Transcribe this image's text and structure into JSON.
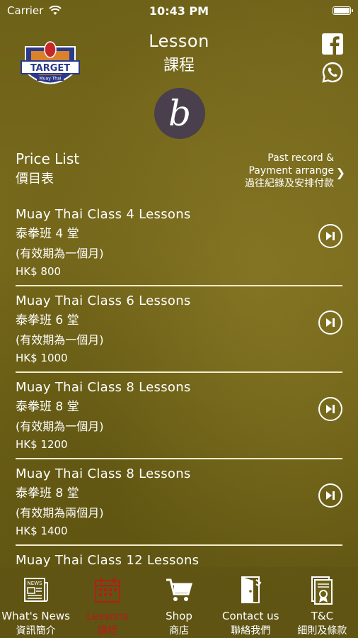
{
  "status": {
    "carrier": "Carrier",
    "time": "10:43 PM"
  },
  "header": {
    "title": "Lesson",
    "title_zh": "課程",
    "badge_letter": "b",
    "logo_text": "TARGET",
    "logo_subtext": "Muay Thai"
  },
  "price_list": {
    "title": "Price List",
    "title_zh": "價目表",
    "past_record_line1": "Past record &",
    "past_record_line2": "Payment arrange",
    "past_record_zh": "過往紀錄及安排付款",
    "chevron": "❯"
  },
  "lessons": [
    {
      "title": "Muay Thai Class 4 Lessons",
      "title_zh": "泰拳班 4 堂",
      "validity": "(有效期為一個月)",
      "price": "HK$ 800"
    },
    {
      "title": "Muay Thai Class 6 Lessons",
      "title_zh": "泰拳班 6 堂",
      "validity": "(有效期為一個月)",
      "price": "HK$ 1000"
    },
    {
      "title": "Muay Thai Class 8 Lessons",
      "title_zh": "泰拳班 8 堂",
      "validity": "(有效期為一個月)",
      "price": "HK$ 1200"
    },
    {
      "title": "Muay Thai Class 8 Lessons",
      "title_zh": "泰拳班 8 堂",
      "validity": "(有效期為兩個月)",
      "price": "HK$ 1400"
    },
    {
      "title": "Muay Thai Class 12 Lessons",
      "title_zh": "",
      "validity": "",
      "price": ""
    }
  ],
  "tabs": [
    {
      "label": "What's News",
      "label_zh": "資訊簡介",
      "icon": "newspaper-icon"
    },
    {
      "label": "Lessons",
      "label_zh": "課程",
      "icon": "calendar-icon"
    },
    {
      "label": "Shop",
      "label_zh": "商店",
      "icon": "cart-icon"
    },
    {
      "label": "Contact us",
      "label_zh": "聯絡我們",
      "icon": "door-icon"
    },
    {
      "label": "T&C",
      "label_zh": "細則及條款",
      "icon": "document-icon"
    }
  ],
  "colors": {
    "background": "#6a5f17",
    "active_tab": "#b71b1b",
    "badge": "#4a3f4d"
  }
}
